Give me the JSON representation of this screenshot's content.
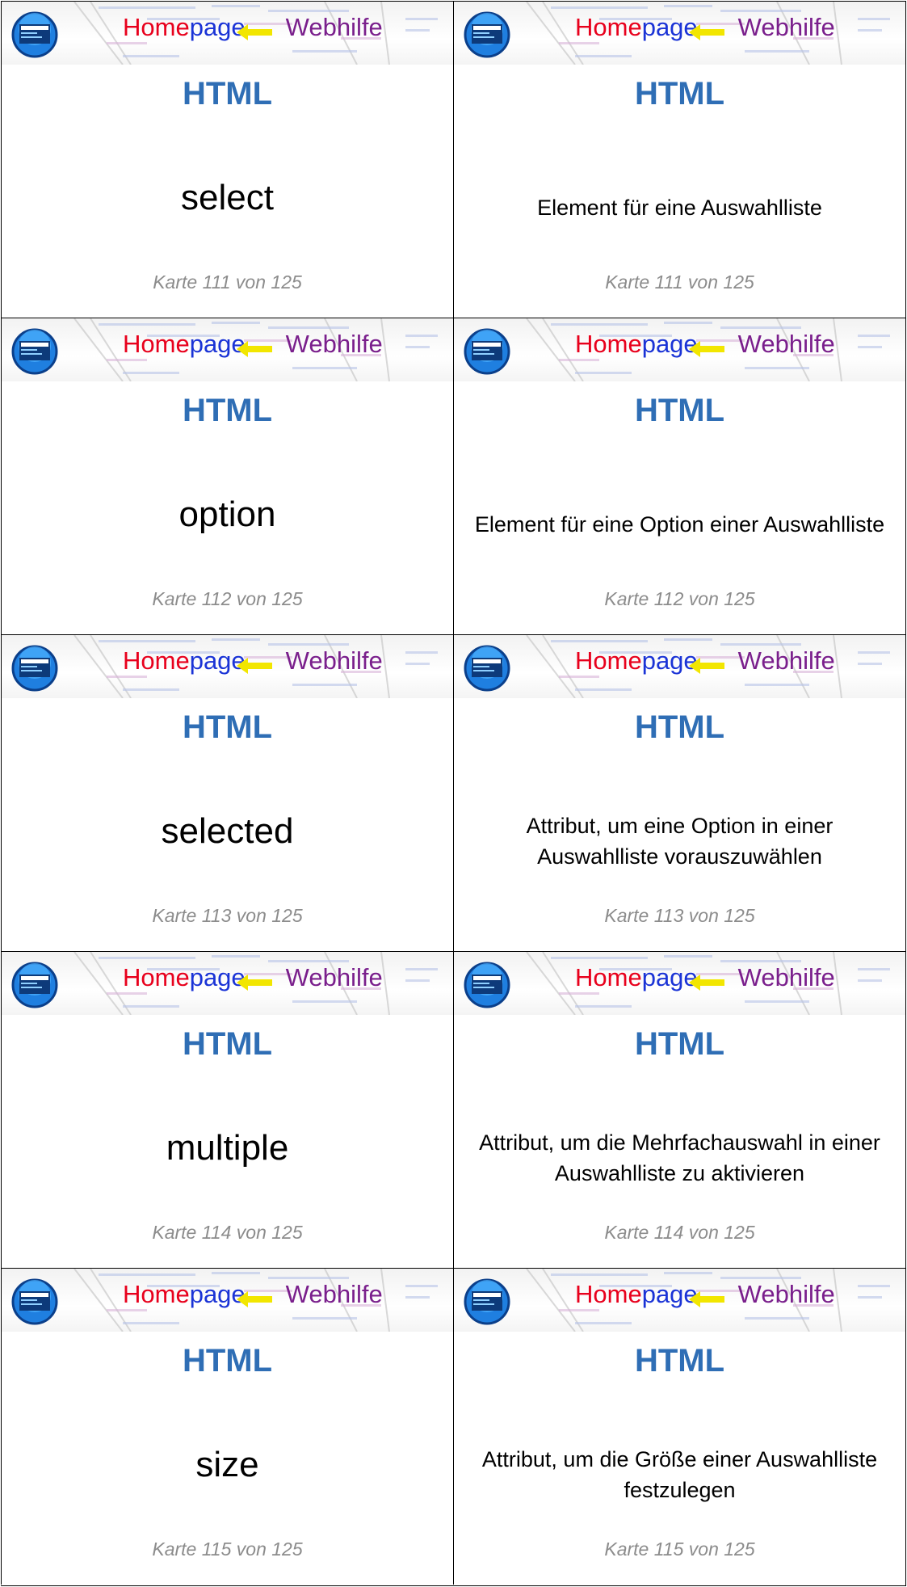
{
  "banner": {
    "title_home": "Home",
    "title_page": "page",
    "title_web": "Webhilfe",
    "logo_icon": "homepage-webhilfe-logo-icon",
    "colors": {
      "home": "#e8001c",
      "page": "#1a33d6",
      "web": "#7a1f8c",
      "arrow": "#f2e600"
    }
  },
  "accent_color": "#2f6eb5",
  "cards": [
    {
      "side": "front",
      "subject": "HTML",
      "text": "select",
      "counter": "Karte 111 von 125"
    },
    {
      "side": "back",
      "subject": "HTML",
      "text": "Element für eine Auswahlliste",
      "counter": "Karte 111 von 125"
    },
    {
      "side": "front",
      "subject": "HTML",
      "text": "option",
      "counter": "Karte 112 von 125"
    },
    {
      "side": "back",
      "subject": "HTML",
      "text": "Element für eine Option einer Auswahlliste",
      "counter": "Karte 112 von 125"
    },
    {
      "side": "front",
      "subject": "HTML",
      "text": "selected",
      "counter": "Karte 113 von 125"
    },
    {
      "side": "back",
      "subject": "HTML",
      "text": "Attribut, um eine Option in einer Auswahlliste vorauszuwählen",
      "counter": "Karte 113 von 125"
    },
    {
      "side": "front",
      "subject": "HTML",
      "text": "multiple",
      "counter": "Karte 114 von 125"
    },
    {
      "side": "back",
      "subject": "HTML",
      "text": "Attribut, um die Mehrfachauswahl in einer Auswahlliste zu aktivieren",
      "counter": "Karte 114 von 125"
    },
    {
      "side": "front",
      "subject": "HTML",
      "text": "size",
      "counter": "Karte 115 von 125"
    },
    {
      "side": "back",
      "subject": "HTML",
      "text": "Attribut, um die Größe einer Auswahlliste festzulegen",
      "counter": "Karte 115 von 125"
    }
  ]
}
